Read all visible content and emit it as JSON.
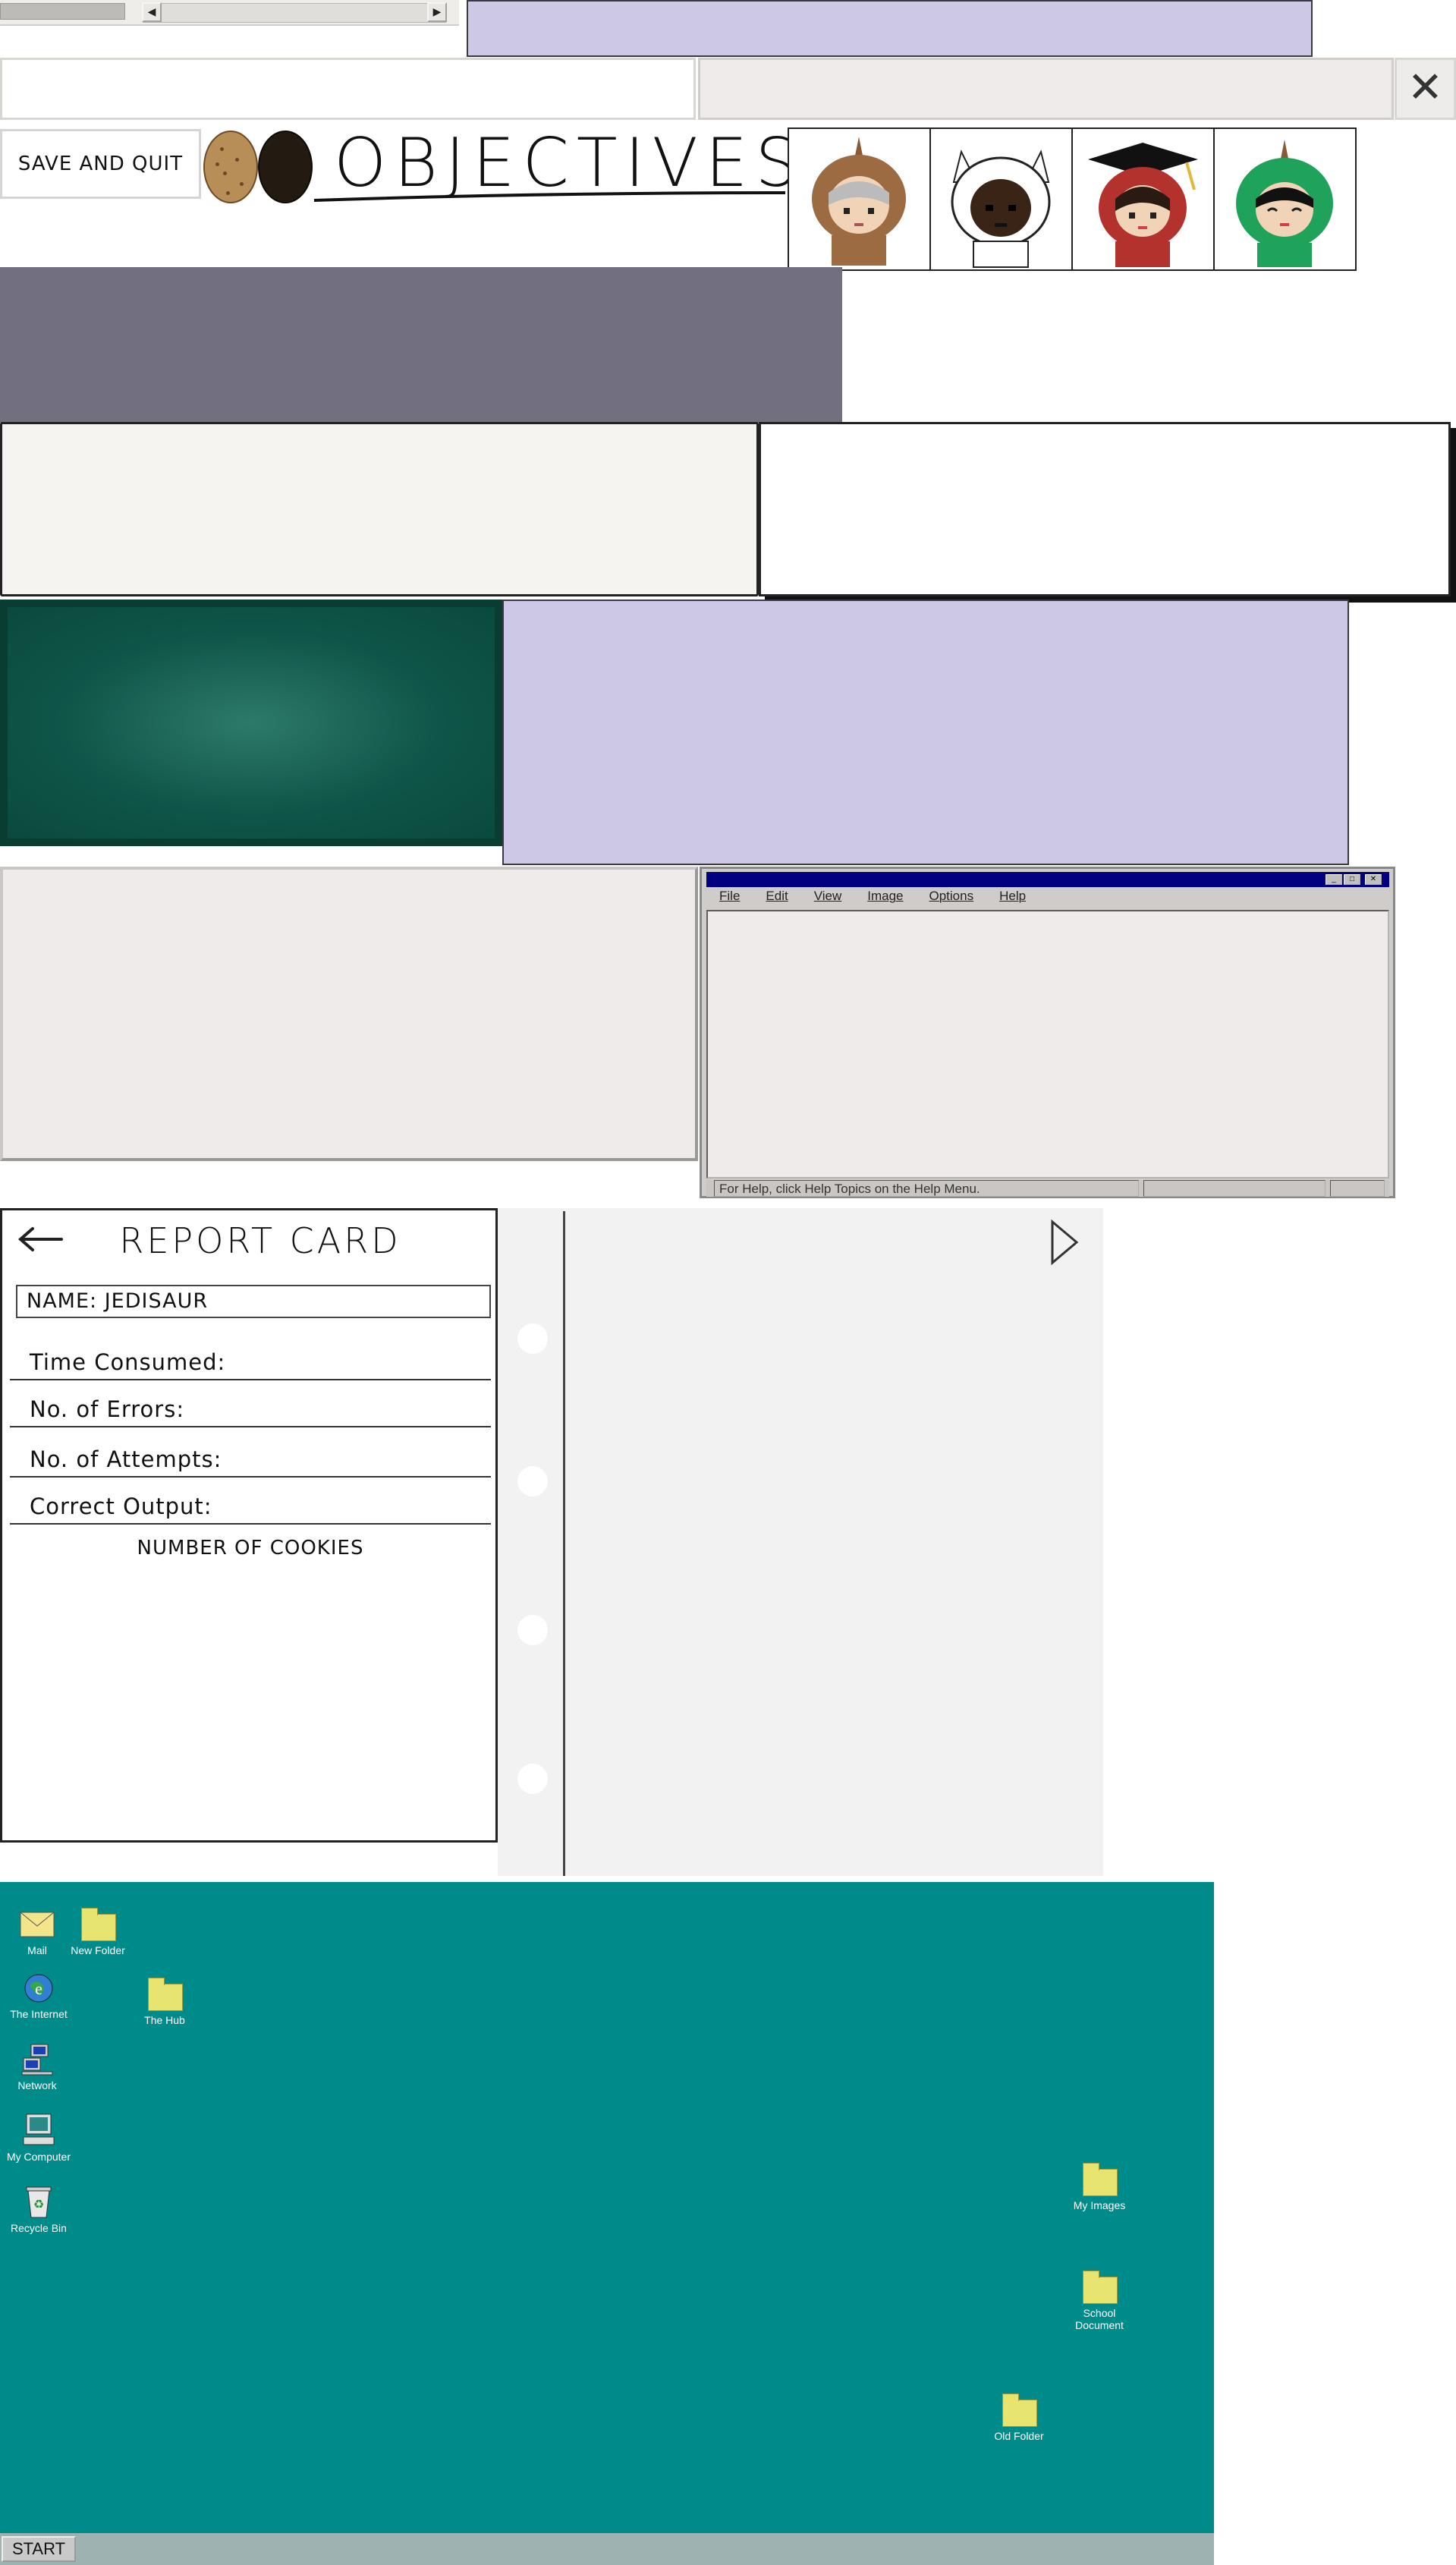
{
  "top": {
    "scrollbar": {
      "left_arrow": "◀",
      "right_arrow": "▶"
    },
    "close_glyph": "✕",
    "save_quit": "SAVE AND QUIT",
    "objectives_title": "OBJECTIVES",
    "avatars": [
      "avatar-brown-hood",
      "avatar-white-cat-hood",
      "avatar-graduation-cap",
      "avatar-green-hood"
    ]
  },
  "paint_window": {
    "menu": [
      "File",
      "Edit",
      "View",
      "Image",
      "Options",
      "Help"
    ],
    "status": "For Help, click Help Topics on the Help Menu.",
    "controls": [
      "_",
      "□",
      "✕"
    ]
  },
  "report_card": {
    "title": "REPORT CARD",
    "name": "NAME: JEDISAUR",
    "rows": [
      "Time Consumed:",
      "No. of Errors:",
      "No. of Attempts:",
      "Correct Output:"
    ],
    "footer": "NUMBER OF COOKIES"
  },
  "desktop": {
    "icons": {
      "mail": "Mail",
      "new_folder": "New Folder",
      "internet": "The Internet",
      "hub": "The Hub",
      "network": "Network",
      "computer": "My Computer",
      "recycle": "Recycle Bin",
      "images": "My Images",
      "school": "School Document",
      "old": "Old Folder"
    },
    "start": "START"
  },
  "colors": {
    "lavender": "#ccc8e6",
    "chalkboard": "#0f5548",
    "desktop_teal": "#008b8b",
    "titlebar": "#000080"
  }
}
